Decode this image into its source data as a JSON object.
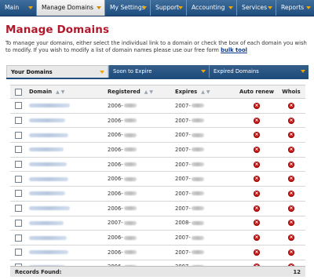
{
  "nav": {
    "tabs": [
      {
        "label": "Main",
        "active": false
      },
      {
        "label": "Manage Domains",
        "active": true
      },
      {
        "label": "My Settings",
        "active": false
      },
      {
        "label": "Support",
        "active": false
      },
      {
        "label": "Accounting",
        "active": false
      },
      {
        "label": "Services",
        "active": false
      },
      {
        "label": "Reports",
        "active": false
      }
    ]
  },
  "page": {
    "title": "Manage Domains",
    "intro": "To manage your domains, either select the individual link to a domain or check the box of each domain you wish to modify. If you wish to modify a list of domain names please use our free form",
    "intro_link": "bulk tool"
  },
  "subtabs": [
    {
      "label": "Your Domains",
      "active": true
    },
    {
      "label": "Soon to Expire",
      "active": false
    },
    {
      "label": "Expired Domains",
      "active": false
    }
  ],
  "table": {
    "headers": {
      "domain": "Domain",
      "registered": "Registered",
      "expires": "Expires",
      "auto_renew": "Auto renew",
      "whois": "Whois"
    },
    "rows": [
      {
        "registered": "2006-",
        "expires": "2007-"
      },
      {
        "registered": "2006-",
        "expires": "2007-"
      },
      {
        "registered": "2006-",
        "expires": "2007-"
      },
      {
        "registered": "2006-",
        "expires": "2007-"
      },
      {
        "registered": "2006-",
        "expires": "2007-"
      },
      {
        "registered": "2006-",
        "expires": "2007-"
      },
      {
        "registered": "2006-",
        "expires": "2007-"
      },
      {
        "registered": "2006-",
        "expires": "2007-"
      },
      {
        "registered": "2007-",
        "expires": "2008-"
      },
      {
        "registered": "2006-",
        "expires": "2007-"
      },
      {
        "registered": "2006-",
        "expires": "2007-"
      },
      {
        "registered": "2006-",
        "expires": "2007-"
      }
    ]
  },
  "footer": {
    "label": "Records Found:",
    "count": "12"
  },
  "colors": {
    "nav_blue": "#1e4c7c",
    "title_red": "#b0192b",
    "arrow_orange": "#f0a800",
    "status_red": "#c81a1a"
  },
  "icons": {
    "auto_renew": "x-circle-icon",
    "whois": "x-circle-icon"
  }
}
